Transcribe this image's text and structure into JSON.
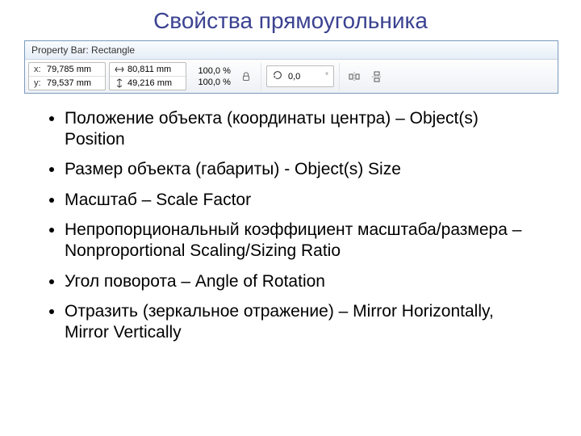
{
  "title": "Свойства прямоугольника",
  "propbar": {
    "caption": "Property Bar: Rectangle",
    "x_label": "x:",
    "y_label": "y:",
    "x_value": "79,785 mm",
    "y_value": "79,537 mm",
    "w_value": "80,811 mm",
    "h_value": "49,216 mm",
    "scale_x": "100,0",
    "scale_y": "100,0",
    "percent": "%",
    "angle": "0,0",
    "degree": "°"
  },
  "bullets": [
    "Положение объекта (координаты центра) – Object(s) Position",
    "Размер объекта (габариты) - Object(s) Size",
    "Масштаб – Scale Factor",
    "Непропорциональный коэффициент масштаба/размера – Nonproportional Scaling/Sizing Ratio",
    "Угол поворота – Angle of Rotation",
    "Отразить (зеркальное отражение) – Mirror Horizontally, Mirror Vertically"
  ]
}
